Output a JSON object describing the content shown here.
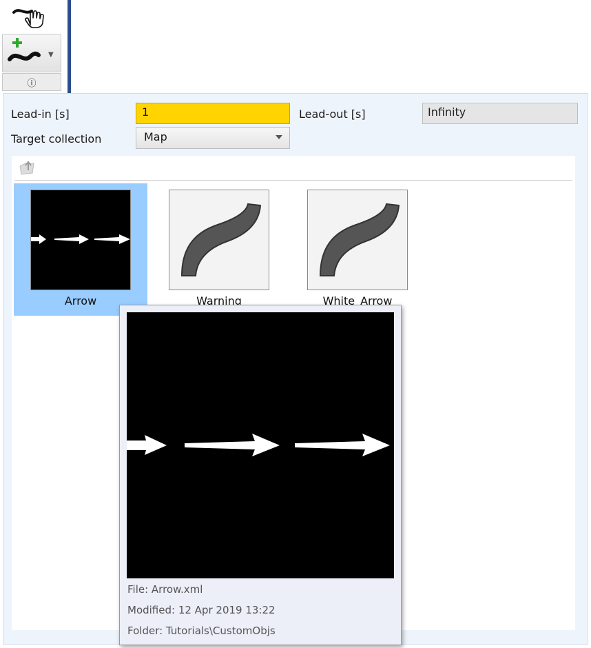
{
  "toolbar": {
    "pan_icon": "hand-pan-icon",
    "add_icon": "add-path-icon",
    "info_icon": "info-circle-icon",
    "info_glyph": "ⓘ"
  },
  "form": {
    "lead_in_label": "Lead-in [s]",
    "lead_in_value": "1",
    "lead_out_label": "Lead-out [s]",
    "lead_out_value": "Infinity",
    "target_label": "Target collection",
    "target_value": "Map"
  },
  "browser": {
    "up_icon": "folder-up-icon",
    "items": [
      {
        "label": "Arrow",
        "selected": true
      },
      {
        "label": "Warning",
        "selected": false
      },
      {
        "label": "White_Arrow",
        "selected": false
      }
    ]
  },
  "tooltip": {
    "file": "File: Arrow.xml",
    "modified": "Modified: 12 Apr 2019 13:22",
    "folder": "Folder: Tutorials\\CustomObjs"
  },
  "colors": {
    "lead_in_bg": "#ffd400",
    "selection_bg": "#99ccff",
    "panel_bg": "#eef4fb",
    "accent_bar": "#2b4f8c"
  }
}
